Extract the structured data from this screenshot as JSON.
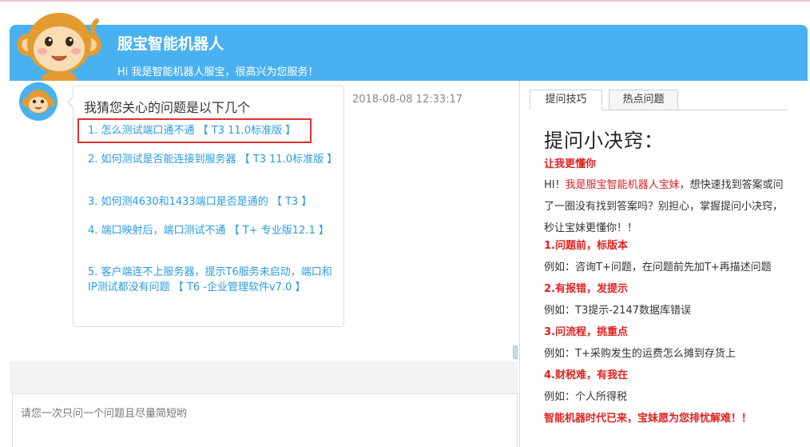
{
  "header": {
    "title": "服宝智能机器人",
    "subtitle": "Hi 我是智能机器人服宝，很高兴为您服务！"
  },
  "chat": {
    "timestamp": "2018-08-08 12:33:17",
    "bubble_title": "我猜您关心的问题是以下几个",
    "questions": [
      "1. 怎么测试端口通不通 【 T3 11.0标准版 】",
      "2. 如何测试是否能连接到服务器 【 T3 11.0标准版 】",
      "3. 如何测4630和1433端口是否是通的 【 T3 】",
      "4. 端口映射后，端口测试不通 【 T+ 专业版12.1 】",
      "5. 客户端连不上服务器，提示T6服务未启动，端口和IP测试都没有问题 【 T6 -企业管理软件v7.0 】"
    ]
  },
  "input": {
    "placeholder": "请您一次只问一个问题且尽量简短哟"
  },
  "tabs": [
    {
      "label": "提问技巧"
    },
    {
      "label": "热点问题"
    }
  ],
  "tips": {
    "title": "提问小决窍：",
    "heading": "让我更懂你",
    "intro_prefix": "HI！",
    "intro_highlight": "我是服宝智能机器人宝妹",
    "intro_rest": "，想快速找到答案或问了一圈没有找到答案吗？别担心，掌握提问小决窍，秒让宝妹更懂你！！",
    "items": [
      {
        "title": "1.问题前，标版本",
        "example": "例如：咨询T+问题，在问题前先加T+再描述问题"
      },
      {
        "title": "2.有报错，发提示",
        "example": "例如：T3提示-2147数据库错误"
      },
      {
        "title": "3.问流程，挑重点",
        "example": "例如：T+采购发生的运费怎么摊到存货上"
      },
      {
        "title": "4.财税难，有我在",
        "example": "例如：个人所得税"
      }
    ],
    "footer": "智能机器时代已来，宝妹愿为您排忧解难！！"
  },
  "colors": {
    "header_bg": "#4ab1f1",
    "link": "#2a9be0",
    "emphasis": "#e02222",
    "highlight_box": "#e33030"
  }
}
